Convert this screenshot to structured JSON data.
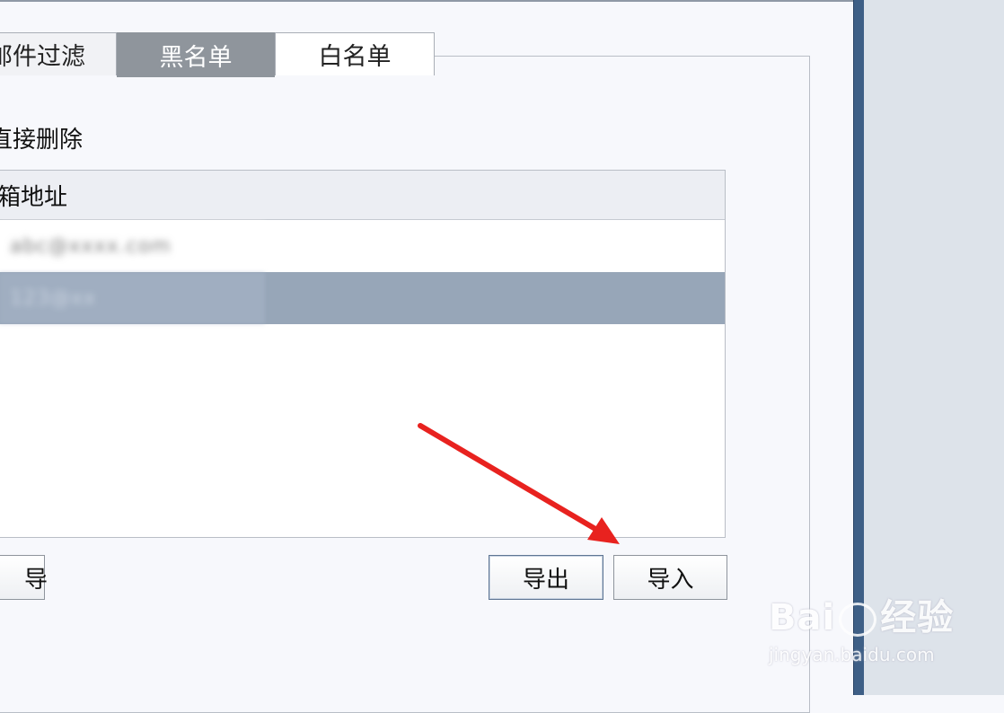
{
  "tabs": [
    {
      "label": "邮件过滤",
      "active": false
    },
    {
      "label": "黑名单",
      "active": true
    },
    {
      "label": "白名单",
      "active": false
    }
  ],
  "description": "直接删除",
  "list": {
    "header": "邮箱地址",
    "rows": [
      {
        "text": "abc@xxxx.com",
        "selected": false
      },
      {
        "text": "123@xx",
        "selected": true
      }
    ]
  },
  "buttons": {
    "left_partial": "导",
    "export": "导出",
    "import": "导入"
  },
  "watermark": {
    "brand": "Bai",
    "brand_suffix": "经验",
    "url": "jingyan.baidu.com"
  },
  "colors": {
    "active_tab": "#8f959c",
    "selected_row": "#97a6b8",
    "arrow": "#e8221f",
    "right_divider": "#3e5f86"
  }
}
